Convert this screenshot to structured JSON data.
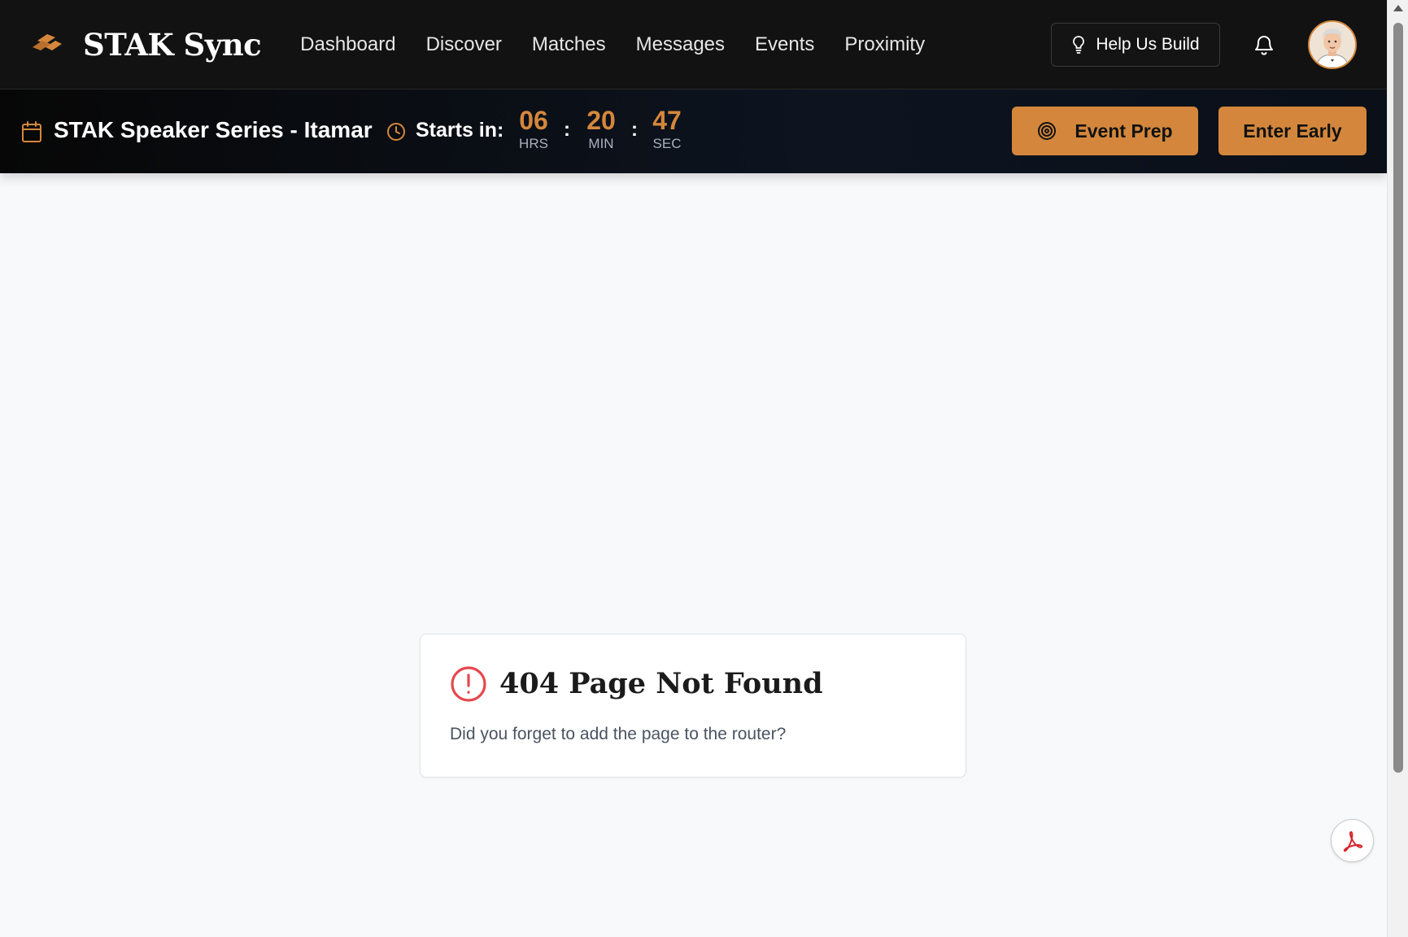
{
  "app": {
    "name": "STAK Sync",
    "accent_color": "#d4873c",
    "navbar_bg": "#121212"
  },
  "nav": {
    "items": [
      {
        "label": "Dashboard"
      },
      {
        "label": "Discover"
      },
      {
        "label": "Matches"
      },
      {
        "label": "Messages"
      },
      {
        "label": "Events"
      },
      {
        "label": "Proximity"
      }
    ],
    "help_button": {
      "label": "Help Us Build",
      "icon": "lightbulb-icon"
    },
    "notifications_icon": "bell-icon",
    "avatar_icon": "user-avatar"
  },
  "event_banner": {
    "title": "STAK Speaker Series - Itamar",
    "starts_in_label": "Starts in:",
    "countdown": {
      "hours": "06",
      "hours_label": "HRS",
      "minutes": "20",
      "minutes_label": "MIN",
      "seconds": "47",
      "seconds_label": "SEC",
      "separator": ":"
    },
    "event_prep_button": {
      "label": "Event Prep",
      "icon": "target-icon"
    },
    "enter_early_button": {
      "label": "Enter Early"
    }
  },
  "error_card": {
    "icon": "alert-circle-icon",
    "icon_color": "#e5484d",
    "title": "404 Page Not Found",
    "message": "Did you forget to add the page to the router?"
  },
  "floating_button": {
    "icon": "pdf-icon",
    "icon_color": "#d7262e"
  }
}
